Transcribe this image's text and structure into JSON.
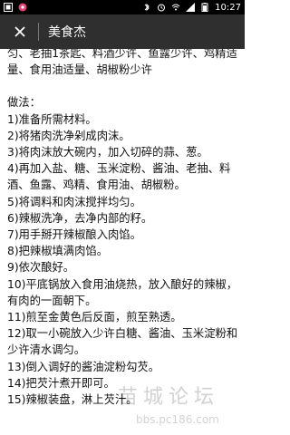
{
  "status_bar": {
    "time": "10:27",
    "icons": [
      "app-badge-icon",
      "flower-icon",
      "bluetooth-icon",
      "alarm-icon",
      "wifi-icon",
      "signal-icon",
      "battery-icon"
    ]
  },
  "app_bar": {
    "title": "美食杰",
    "close_icon": "close-icon"
  },
  "content": {
    "ingredients_lines": [
      "匀、老抽1茶匙、料酒少许、鱼露少许、鸡精适",
      "量、食用油适量、胡椒粉少许"
    ],
    "method_title": "做法：",
    "steps": [
      "1)准备所需材料。",
      "2)将猪肉洗净剁成肉沫。",
      "3)将肉沫放大碗内，加入切碎的蒜、葱。",
      "4)再加入盐、糖、玉米淀粉、酱油、老抽、料",
      "酒、鱼露、鸡精、食用油、胡椒粉。",
      "5)将调料和肉沫搅拌均匀。",
      "6)辣椒洗净，去净内部的籽。",
      "7)用手掰开辣椒酿入肉馅。",
      "8)把辣椒填满肉馅。",
      "9)依次酿好。",
      "10)平底锅放入食用油烧热，放入酿好的辣椒，",
      "有肉的一面朝下。",
      "11)煎至金黄色后反面，煎至熟透。",
      "12)取一小碗放入少许白糖、酱油、玉米淀粉和",
      "少许清水调匀。",
      "13)倒入调好的酱油淀粉勾芡。",
      "14)把芡汁煮开即可。",
      "15)辣椒装盘，淋上芡汁。"
    ]
  },
  "watermark": {
    "main": "苗城论坛",
    "sub": "bbs.pc186.com"
  }
}
